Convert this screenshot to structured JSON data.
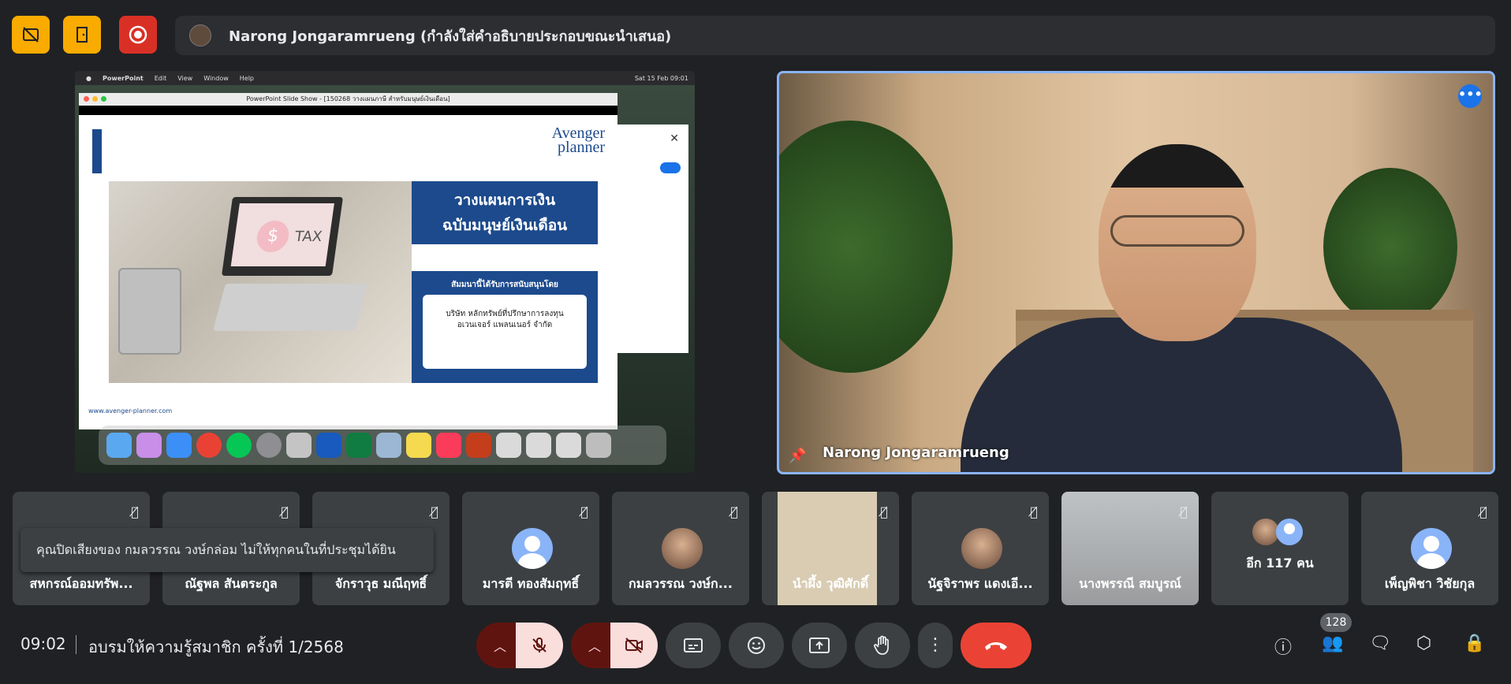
{
  "header": {
    "presenter_label": "Narong Jongaramrueng (กำลังใส่คำอธิบายประกอบขณะนำเสนอ)"
  },
  "share": {
    "mac_menu": [
      "PowerPoint",
      "Edit",
      "View",
      "Window",
      "Help"
    ],
    "mac_status": "Sat 15 Feb 09:01",
    "ppt_title": "PowerPoint Slide Show - [150268 วางแผนภาษี สำหรับมนุษย์เงินเดือน]",
    "slide": {
      "logo_line1": "Avenger",
      "logo_line2": "planner",
      "title_line1": "วางแผนการเงิน",
      "title_line2": "ฉบับมนุษย์เงินเดือน",
      "sponsor_heading": "สัมมนานี้ได้รับการสนับสนุนโดย",
      "sponsor_line1": "บริษัท หลักทรัพย์ที่ปรึกษาการลงทุน",
      "sponsor_line2": "อเวนเจอร์ แพลนเนอร์ จำกัด",
      "photo_text": "TAX",
      "coin_text": "$",
      "url": "www.avenger-planner.com"
    }
  },
  "main_video": {
    "name": "Narong Jongaramrueng"
  },
  "participants": [
    {
      "name": "สหกรณ์ออมทรัพ..."
    },
    {
      "name": "ณัฐพล สันตระกูล"
    },
    {
      "name": "จักราวุธ มณีฤทธิ์"
    },
    {
      "name": "มารตี ทองสัมฤทธิ์"
    },
    {
      "name": "กมลวรรณ วงษ์ก..."
    },
    {
      "name": "นำผึ้ง วุฒิศักดิ์"
    },
    {
      "name": "นัฐจิราพร แดงเอี..."
    },
    {
      "name": "นางพรรณี สมบูรณ์"
    },
    {
      "name": "อีก 117 คน"
    },
    {
      "name": "เพ็ญพิชา วิชัยกุล"
    }
  ],
  "toast": {
    "message": "คุณปิดเสียงของ กมลวรรณ วงษ์กล่อม ไม่ให้ทุกคนในที่ประชุมได้ยิน"
  },
  "footer": {
    "time": "09:02",
    "meeting_title": "อบรมให้ความรู้สมาชิก ครั้งที่ 1/2568",
    "participant_count": "128"
  },
  "colors": {
    "background": "#202124",
    "tile": "#3c4043",
    "accent_blue": "#1a73e8",
    "warning_yellow": "#f9ab00",
    "record_red": "#d93025",
    "end_call_red": "#ea4335"
  }
}
